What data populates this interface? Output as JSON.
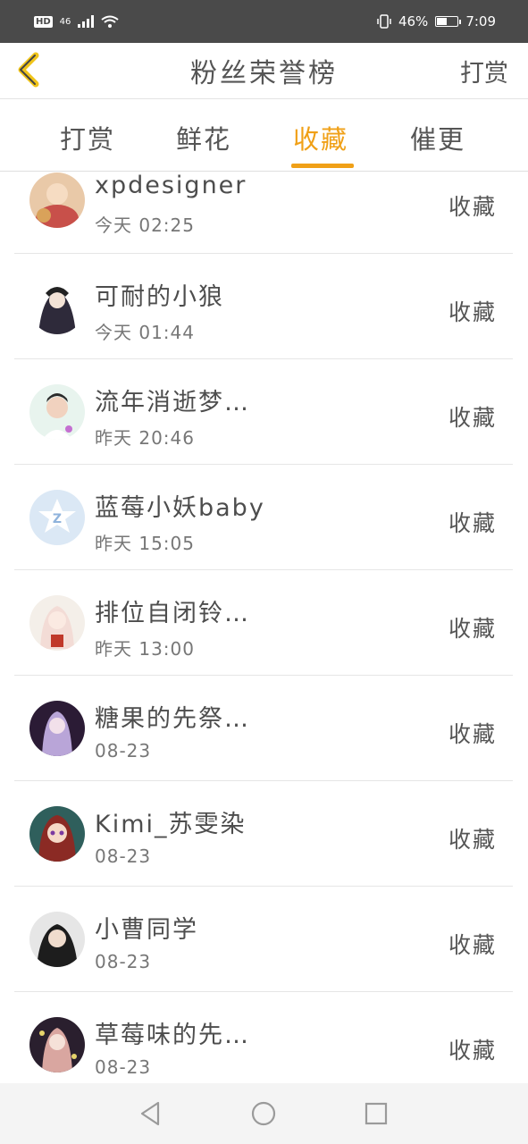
{
  "status_bar": {
    "hd": "HD",
    "network": "46",
    "battery_text": "46%",
    "battery_level": 0.46,
    "time": "7:09",
    "icons": [
      "hd-icon",
      "signal-icon",
      "wifi-icon",
      "vibrate-icon",
      "battery-icon"
    ]
  },
  "header": {
    "title": "粉丝荣誉榜",
    "action": "打赏",
    "back_icon": "chevron-left-icon",
    "back_color": "#f0c419"
  },
  "tabs": [
    {
      "label": "打赏",
      "active": false
    },
    {
      "label": "鲜花",
      "active": false
    },
    {
      "label": "收藏",
      "active": true
    },
    {
      "label": "催更",
      "active": false
    }
  ],
  "accent_color": "#f0a017",
  "list": [
    {
      "name": "xpdesigner",
      "time": "今天 02:25",
      "action": "收藏"
    },
    {
      "name": "可耐的小狼",
      "time": "今天 01:44",
      "action": "收藏"
    },
    {
      "name": "流年消逝梦…",
      "time": "昨天 20:46",
      "action": "收藏"
    },
    {
      "name": "蓝莓小妖baby",
      "time": "昨天 15:05",
      "action": "收藏"
    },
    {
      "name": "排位自闭铃…",
      "time": "昨天 13:00",
      "action": "收藏"
    },
    {
      "name": "糖果的先祭…",
      "time": "08-23",
      "action": "收藏"
    },
    {
      "name": "Kimi_苏雯染",
      "time": "08-23",
      "action": "收藏"
    },
    {
      "name": "小曹同学",
      "time": "08-23",
      "action": "收藏"
    },
    {
      "name": "草莓味的先…",
      "time": "08-23",
      "action": "收藏"
    }
  ],
  "nav_bar": {
    "icons": [
      "back-triangle-icon",
      "home-circle-icon",
      "recents-square-icon"
    ]
  }
}
